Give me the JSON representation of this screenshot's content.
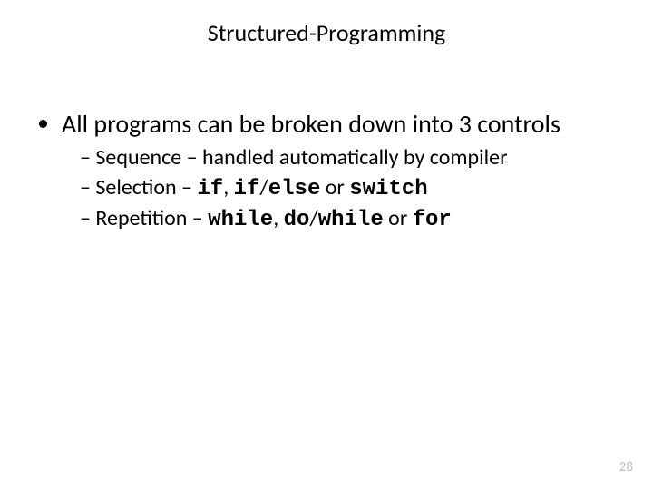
{
  "title": "Structured-Programming",
  "main_bullet": "All programs can be broken down into 3 controls",
  "sub": {
    "sequence": {
      "label": "Sequence",
      "desc": "handled automatically by compiler"
    },
    "selection": {
      "label": "Selection",
      "kw_if": "if",
      "sep1": ", ",
      "kw_if2": "if",
      "slash": "/",
      "kw_else": "else",
      "or": " or ",
      "kw_switch": "switch"
    },
    "repetition": {
      "label": "Repetition",
      "kw_while": "while",
      "sep1": ", ",
      "kw_do": "do",
      "slash": "/",
      "kw_while2": "while",
      "or": " or ",
      "kw_for": "for"
    }
  },
  "page_number": "28"
}
